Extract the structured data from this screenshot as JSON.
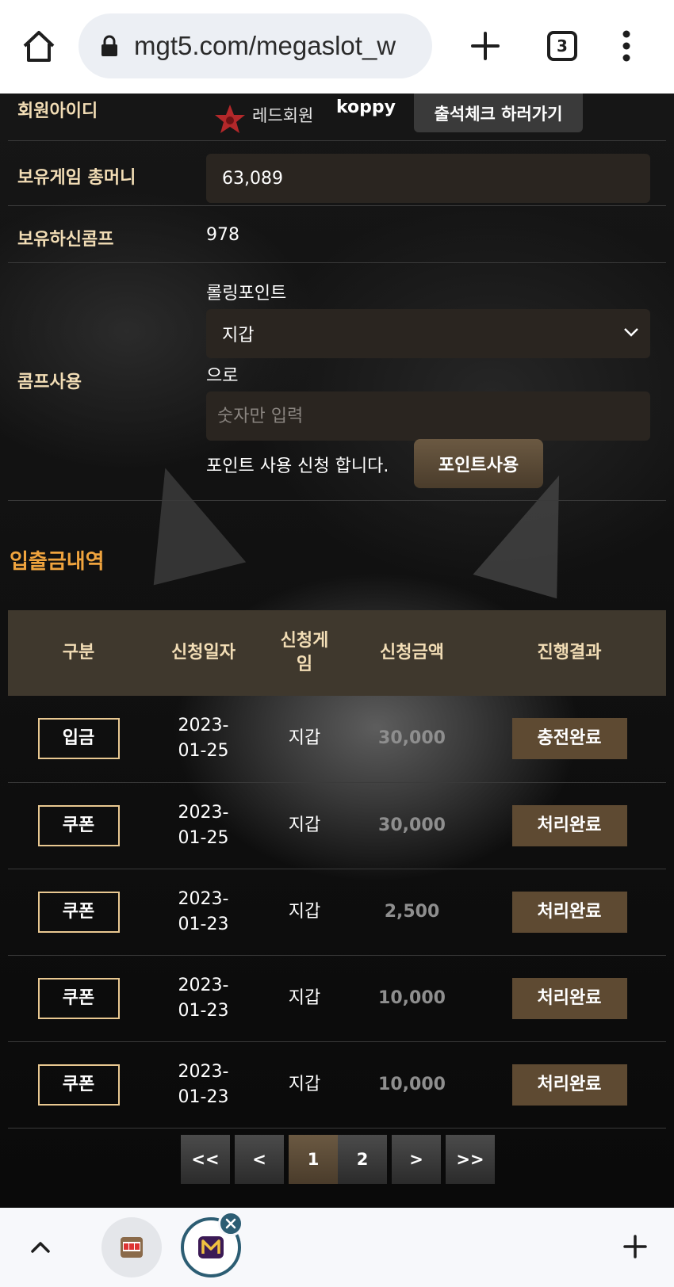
{
  "browser": {
    "url": "mgt5.com/megaslot_w",
    "tab_count": "3"
  },
  "member": {
    "id_label": "회원아이디",
    "grade": "레드회원",
    "user_id": "koppy",
    "checkin_button": "출석체크 하러가기"
  },
  "money": {
    "label": "보유게임 총머니",
    "value": "63,089"
  },
  "comp": {
    "label": "보유하신콤프",
    "value": "978"
  },
  "comp_use": {
    "label": "콤프사용",
    "rolling_label": "롤링포인트",
    "select_value": "지갑",
    "to_label": "으로",
    "input_placeholder": "숫자만 입력",
    "request_text": "포인트 사용 신청 합니다.",
    "use_button": "포인트사용"
  },
  "history": {
    "title": "입출금내역",
    "headers": [
      "구분",
      "신청일자",
      "신청게임",
      "신청금액",
      "진행결과"
    ],
    "rows": [
      {
        "type": "입금",
        "date": "2023-01-25",
        "game": "지갑",
        "amount": "30,000",
        "result": "충전완료"
      },
      {
        "type": "쿠폰",
        "date": "2023-01-25",
        "game": "지갑",
        "amount": "30,000",
        "result": "처리완료"
      },
      {
        "type": "쿠폰",
        "date": "2023-01-23",
        "game": "지갑",
        "amount": "2,500",
        "result": "처리완료"
      },
      {
        "type": "쿠폰",
        "date": "2023-01-23",
        "game": "지갑",
        "amount": "10,000",
        "result": "처리완료"
      },
      {
        "type": "쿠폰",
        "date": "2023-01-23",
        "game": "지갑",
        "amount": "10,000",
        "result": "처리완료"
      }
    ]
  },
  "pagination": {
    "first": "<<",
    "prev": "<",
    "pages": [
      "1",
      "2"
    ],
    "current": "1",
    "next": ">",
    "last": ">>"
  },
  "colors": {
    "label_gold": "#f2ddb5",
    "section_orange": "#f0a43e",
    "header_bg": "#3f382d",
    "status_bg": "#5e4a32",
    "input_bg": "#2a2520"
  }
}
